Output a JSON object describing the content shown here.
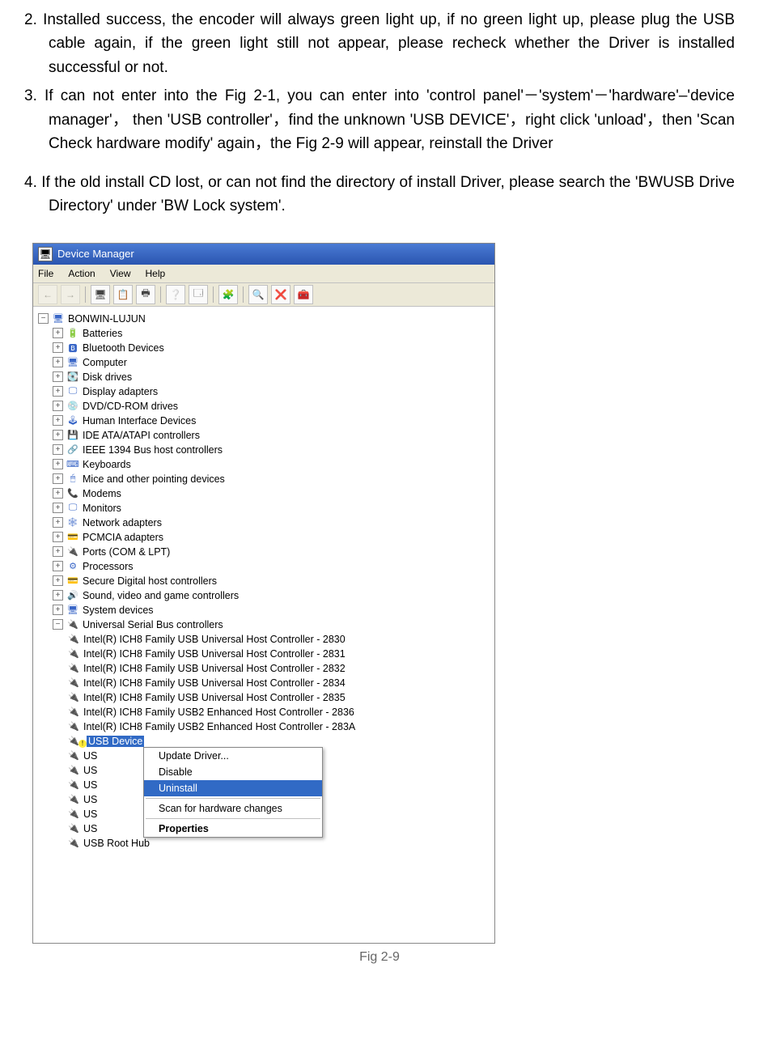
{
  "instructions": {
    "i2": "2.    Installed success, the encoder will always green light up, if no green light up, please plug the USB cable again, if the green light still not appear, please recheck whether the Driver is installed successful or not.",
    "i3": "3.    If can not enter into the Fig 2-1, you can enter into 'control panel'－'system'－'hardware'–'device manager'， then 'USB controller'，find the unknown 'USB DEVICE'，right click 'unload'，then 'Scan Check hardware modify' again，the Fig 2-9 will appear, reinstall the Driver",
    "i4": "4.    If the old install CD lost, or can not find the directory of install Driver, please search the 'BWUSB Drive Directory' under 'BW Lock system'."
  },
  "devmgr": {
    "title": "Device Manager",
    "menus": {
      "file": "File",
      "action": "Action",
      "view": "View",
      "help": "Help"
    },
    "root": "BONWIN-LUJUN",
    "cats": [
      "Batteries",
      "Bluetooth Devices",
      "Computer",
      "Disk drives",
      "Display adapters",
      "DVD/CD-ROM drives",
      "Human Interface Devices",
      "IDE ATA/ATAPI controllers",
      "IEEE 1394 Bus host controllers",
      "Keyboards",
      "Mice and other pointing devices",
      "Modems",
      "Monitors",
      "Network adapters",
      "PCMCIA adapters",
      "Ports (COM & LPT)",
      "Processors",
      "Secure Digital host controllers",
      "Sound, video and game controllers",
      "System devices",
      "Universal Serial Bus controllers"
    ],
    "usb": {
      "ich": [
        "Intel(R) ICH8 Family USB Universal Host Controller - 2830",
        "Intel(R) ICH8 Family USB Universal Host Controller - 2831",
        "Intel(R) ICH8 Family USB Universal Host Controller - 2832",
        "Intel(R) ICH8 Family USB Universal Host Controller - 2834",
        "Intel(R) ICH8 Family USB Universal Host Controller - 2835",
        "Intel(R) ICH8 Family USB2 Enhanced Host Controller - 2836",
        "Intel(R) ICH8 Family USB2 Enhanced Host Controller - 283A"
      ],
      "sel": "USB Device",
      "trunc": [
        "US",
        "US",
        "US",
        "US",
        "US",
        "US"
      ],
      "last": "USB Root Hub"
    },
    "ctx": {
      "update": "Update Driver...",
      "disable": "Disable",
      "uninstall": "Uninstall",
      "scan": "Scan for hardware changes",
      "props": "Properties"
    }
  },
  "caption": "Fig 2-9"
}
